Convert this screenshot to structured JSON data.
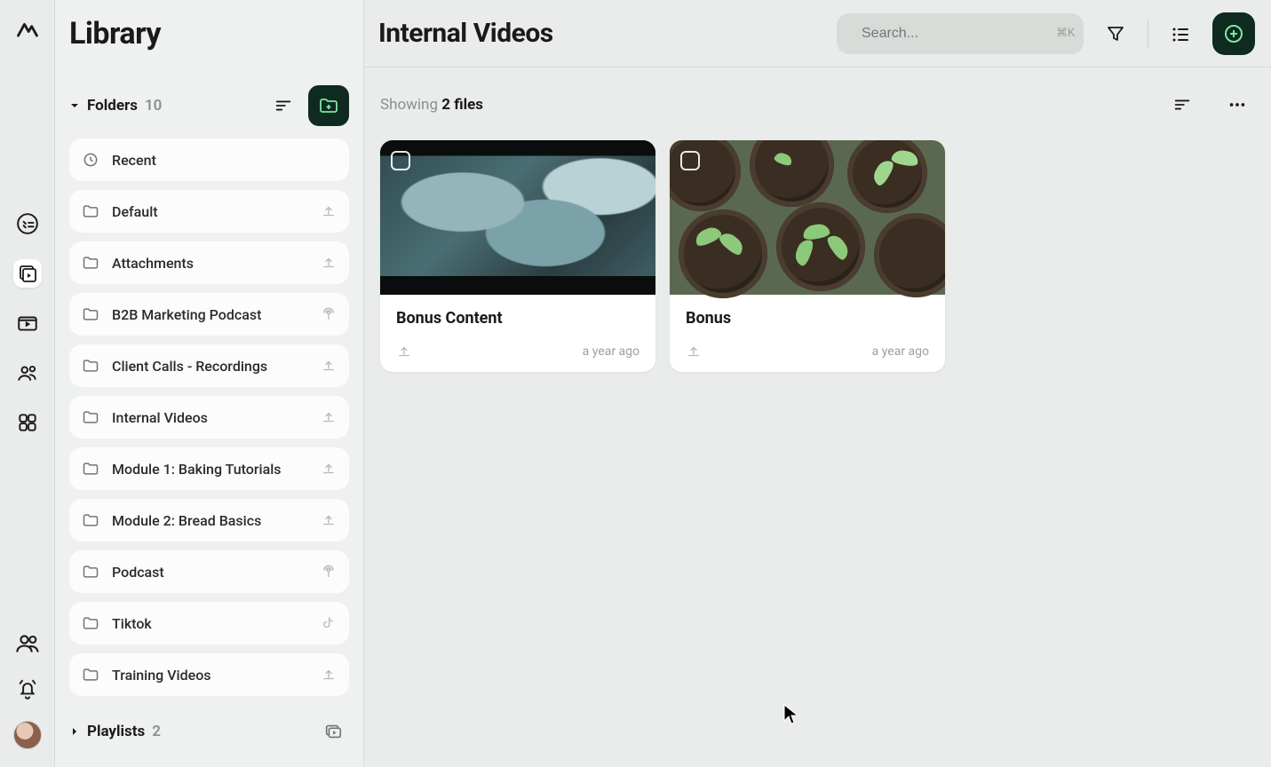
{
  "sidebar": {
    "title": "Library",
    "folders_label": "Folders",
    "folders_count": "10",
    "playlists_label": "Playlists",
    "playlists_count": "2",
    "items": [
      {
        "name": "Recent",
        "icon": "clock",
        "trail": null,
        "selected": false
      },
      {
        "name": "Default",
        "icon": "folder",
        "trail": "upload",
        "selected": false
      },
      {
        "name": "Attachments",
        "icon": "folder",
        "trail": "upload",
        "selected": false
      },
      {
        "name": "B2B Marketing Podcast",
        "icon": "folder",
        "trail": "podcast",
        "selected": false
      },
      {
        "name": "Client Calls - Recordings",
        "icon": "folder",
        "trail": "upload",
        "selected": false
      },
      {
        "name": "Internal Videos",
        "icon": "folder",
        "trail": "upload",
        "selected": true
      },
      {
        "name": "Module 1: Baking Tutorials",
        "icon": "folder",
        "trail": "upload",
        "selected": false
      },
      {
        "name": "Module 2: Bread Basics",
        "icon": "folder",
        "trail": "upload",
        "selected": false
      },
      {
        "name": "Podcast",
        "icon": "folder",
        "trail": "podcast",
        "selected": false
      },
      {
        "name": "Tiktok",
        "icon": "folder",
        "trail": "tiktok",
        "selected": false
      },
      {
        "name": "Training Videos",
        "icon": "folder",
        "trail": "upload",
        "selected": false
      }
    ]
  },
  "topbar": {
    "title": "Internal Videos",
    "search_placeholder": "Search...",
    "search_shortcut": "⌘K"
  },
  "content": {
    "showing_prefix": "Showing ",
    "showing_value": "2 files",
    "cards": [
      {
        "title": "Bonus Content",
        "date": "a year ago",
        "thumb": "ocean"
      },
      {
        "title": "Bonus",
        "date": "a year ago",
        "thumb": "plants"
      }
    ]
  }
}
